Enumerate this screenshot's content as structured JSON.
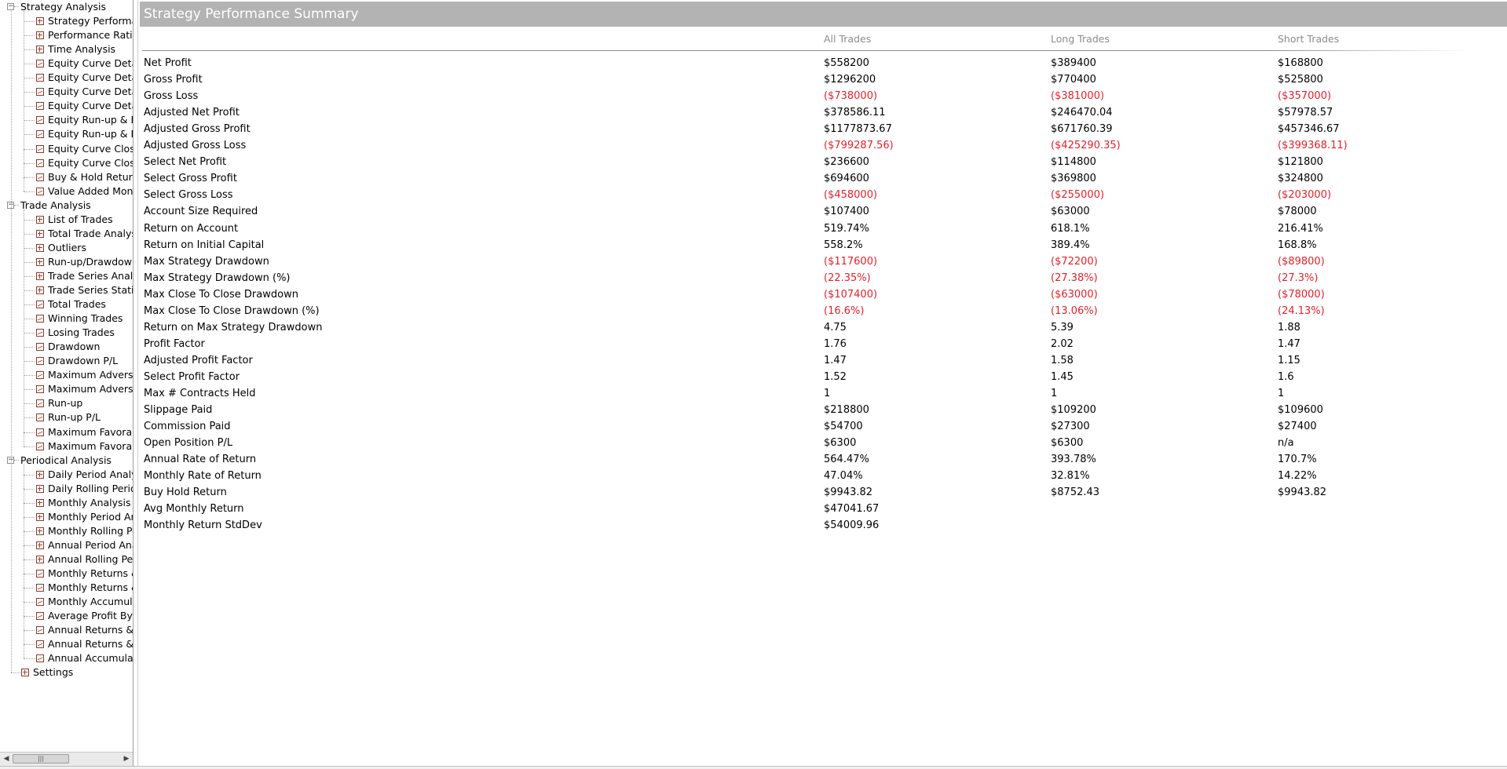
{
  "tree": {
    "groups": [
      {
        "label": "Strategy Analysis",
        "items": [
          {
            "label": "Strategy Performar",
            "icon": "table"
          },
          {
            "label": "Performance Ratios",
            "icon": "table"
          },
          {
            "label": "Time Analysis",
            "icon": "table"
          },
          {
            "label": "Equity Curve Detail",
            "icon": "chart"
          },
          {
            "label": "Equity Curve Detail",
            "icon": "chart"
          },
          {
            "label": "Equity Curve Detail",
            "icon": "chart"
          },
          {
            "label": "Equity Curve Detail",
            "icon": "chart"
          },
          {
            "label": "Equity Run-up & Dr",
            "icon": "chart"
          },
          {
            "label": "Equity Run-up & Dr",
            "icon": "chart"
          },
          {
            "label": "Equity Curve Close",
            "icon": "chart"
          },
          {
            "label": "Equity Curve Close",
            "icon": "chart"
          },
          {
            "label": "Buy & Hold Return",
            "icon": "chart"
          },
          {
            "label": "Value Added Mont",
            "icon": "chart"
          }
        ]
      },
      {
        "label": "Trade Analysis",
        "items": [
          {
            "label": "List of Trades",
            "icon": "table"
          },
          {
            "label": "Total Trade Analysi",
            "icon": "table"
          },
          {
            "label": "Outliers",
            "icon": "table"
          },
          {
            "label": "Run-up/Drawdown",
            "icon": "table"
          },
          {
            "label": "Trade Series Analys",
            "icon": "table"
          },
          {
            "label": "Trade Series Statist",
            "icon": "table"
          },
          {
            "label": "Total Trades",
            "icon": "chart"
          },
          {
            "label": "Winning Trades",
            "icon": "chart"
          },
          {
            "label": "Losing Trades",
            "icon": "chart"
          },
          {
            "label": "Drawdown",
            "icon": "chart"
          },
          {
            "label": "Drawdown P/L",
            "icon": "chart"
          },
          {
            "label": "Maximum Adverse",
            "icon": "chart"
          },
          {
            "label": "Maximum Adverse",
            "icon": "chart"
          },
          {
            "label": "Run-up",
            "icon": "chart"
          },
          {
            "label": "Run-up P/L",
            "icon": "chart"
          },
          {
            "label": "Maximum Favorab",
            "icon": "chart"
          },
          {
            "label": "Maximum Favorab",
            "icon": "chart"
          }
        ]
      },
      {
        "label": "Periodical Analysis",
        "items": [
          {
            "label": "Daily Period Analys",
            "icon": "table"
          },
          {
            "label": "Daily Rolling Perioc",
            "icon": "table"
          },
          {
            "label": "Monthly Analysis",
            "icon": "table"
          },
          {
            "label": "Monthly Period Ana",
            "icon": "table"
          },
          {
            "label": "Monthly Rolling Pe",
            "icon": "table"
          },
          {
            "label": "Annual Period Anal",
            "icon": "table"
          },
          {
            "label": "Annual Rolling Peri",
            "icon": "table"
          },
          {
            "label": "Monthly Returns &",
            "icon": "chart"
          },
          {
            "label": "Monthly Returns &",
            "icon": "chart"
          },
          {
            "label": "Monthly Accumulat",
            "icon": "chart"
          },
          {
            "label": "Average Profit By M",
            "icon": "chart"
          },
          {
            "label": "Annual Returns & D",
            "icon": "chart"
          },
          {
            "label": "Annual Returns & D",
            "icon": "chart"
          },
          {
            "label": "Annual Accumulativ",
            "icon": "chart"
          }
        ]
      }
    ],
    "settings_label": "Settings"
  },
  "report": {
    "title": "Strategy Performance Summary",
    "columns": [
      "All Trades",
      "Long Trades",
      "Short Trades"
    ],
    "rows": [
      [
        "Net Profit",
        "$558200",
        "$389400",
        "$168800"
      ],
      [
        "Gross Profit",
        "$1296200",
        "$770400",
        "$525800"
      ],
      [
        "Gross Loss",
        "($738000)",
        "($381000)",
        "($357000)"
      ],
      [
        "Adjusted Net Profit",
        "$378586.11",
        "$246470.04",
        "$57978.57"
      ],
      [
        "Adjusted Gross Profit",
        "$1177873.67",
        "$671760.39",
        "$457346.67"
      ],
      [
        "Adjusted Gross Loss",
        "($799287.56)",
        "($425290.35)",
        "($399368.11)"
      ],
      [
        "Select Net Profit",
        "$236600",
        "$114800",
        "$121800"
      ],
      [
        "Select Gross Profit",
        "$694600",
        "$369800",
        "$324800"
      ],
      [
        "Select Gross Loss",
        "($458000)",
        "($255000)",
        "($203000)"
      ],
      [
        "Account Size Required",
        "$107400",
        "$63000",
        "$78000"
      ],
      [
        "Return on Account",
        "519.74%",
        "618.1%",
        "216.41%"
      ],
      [
        "Return on Initial Capital",
        "558.2%",
        "389.4%",
        "168.8%"
      ],
      [
        "Max Strategy Drawdown",
        "($117600)",
        "($72200)",
        "($89800)"
      ],
      [
        "Max Strategy Drawdown (%)",
        "(22.35%)",
        "(27.38%)",
        "(27.3%)"
      ],
      [
        "Max Close To Close Drawdown",
        "($107400)",
        "($63000)",
        "($78000)"
      ],
      [
        "Max Close To Close Drawdown (%)",
        "(16.6%)",
        "(13.06%)",
        "(24.13%)"
      ],
      [
        "Return on Max Strategy Drawdown",
        "4.75",
        "5.39",
        "1.88"
      ],
      [
        "Profit Factor",
        "1.76",
        "2.02",
        "1.47"
      ],
      [
        "Adjusted Profit Factor",
        "1.47",
        "1.58",
        "1.15"
      ],
      [
        "Select Profit Factor",
        "1.52",
        "1.45",
        "1.6"
      ],
      [
        "Max # Contracts Held",
        "1",
        "1",
        "1"
      ],
      [
        "Slippage Paid",
        "$218800",
        "$109200",
        "$109600"
      ],
      [
        "Commission Paid",
        "$54700",
        "$27300",
        "$27400"
      ],
      [
        "Open Position P/L",
        "$6300",
        "$6300",
        "n/a"
      ],
      [
        "Annual Rate of Return",
        "564.47%",
        "393.78%",
        "170.7%"
      ],
      [
        "Monthly Rate of Return",
        "47.04%",
        "32.81%",
        "14.22%"
      ],
      [
        "Buy  Hold Return",
        "$9943.82",
        "$8752.43",
        "$9943.82"
      ],
      [
        "Avg Monthly Return",
        "$47041.67",
        "",
        ""
      ],
      [
        "Monthly Return StdDev",
        "$54009.96",
        "",
        ""
      ]
    ]
  },
  "colors": {
    "negative": "#e8202a",
    "title_bar": "#b3b3b3",
    "column_header": "#8c8c8c"
  }
}
